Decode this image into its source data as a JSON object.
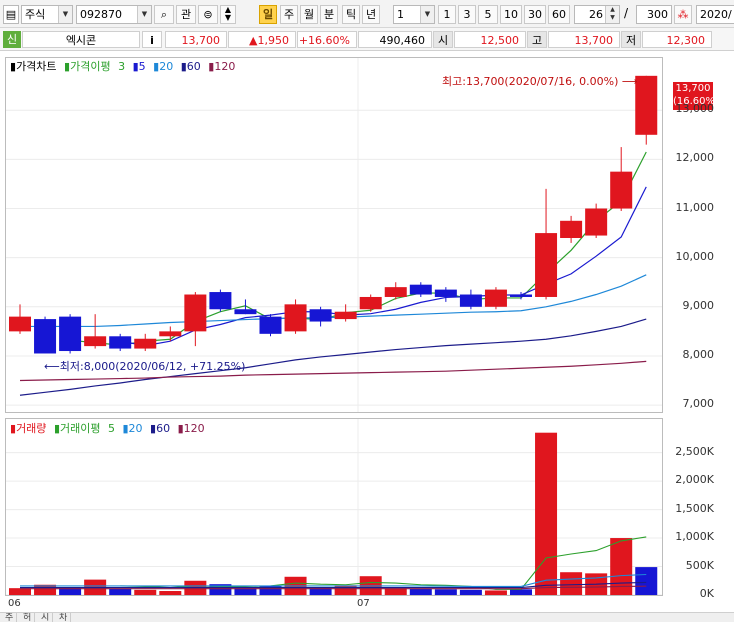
{
  "toolbar": {
    "market": "주식",
    "code": "092870",
    "gwan": "관",
    "periods": [
      "일",
      "주",
      "월",
      "분",
      "틱",
      "년"
    ],
    "active_period": "일",
    "interval": "1",
    "quick": [
      "1",
      "3",
      "5",
      "10",
      "30",
      "60"
    ],
    "count": "26",
    "slash": "/",
    "total": "300",
    "date": "2020/"
  },
  "info": {
    "flag": "신",
    "name": "엑시콘",
    "i": "i",
    "price": "13,700",
    "change": "▲1,950",
    "rate": "+16.60%",
    "volume": "490,460",
    "open_label": "시",
    "open": "12,500",
    "high_label": "고",
    "high": "13,700",
    "low_label": "저",
    "low": "12,300"
  },
  "legend1": {
    "name": "가격차트",
    "ma_label": "가격이평",
    "ma": [
      "3",
      "5",
      "20",
      "60",
      "120"
    ]
  },
  "legend2": {
    "name": "거래량",
    "ma_label": "거래이평",
    "ma": [
      "5",
      "20",
      "60",
      "120"
    ]
  },
  "annotations": {
    "high": "최고:13,700(2020/07/16, 0.00%)",
    "low": "최저:8,000(2020/06/12, +71.25%)",
    "current_price": "13,700",
    "current_rate": "(16.60%)"
  },
  "colors": {
    "up": "#e0161e",
    "down": "#1616d4",
    "ma3": "#2ca02c",
    "ma5": "#1a1ad0",
    "ma20": "#1e88d8",
    "ma60": "#1c1c8a",
    "ma120": "#8a1c4a"
  },
  "bottom_tabs": [
    "주",
    "허",
    "시",
    "차"
  ],
  "chart_data": [
    {
      "type": "candlestick",
      "title": "가격차트",
      "x_ticks": [
        "06",
        "07"
      ],
      "y_ticks": [
        7000,
        8000,
        9000,
        10000,
        11000,
        12000,
        13000
      ],
      "ylim": [
        6900,
        13900
      ],
      "candles": [
        {
          "o": 8500,
          "h": 9050,
          "l": 8450,
          "c": 8800
        },
        {
          "o": 8750,
          "h": 8800,
          "l": 8050,
          "c": 8050
        },
        {
          "o": 8800,
          "h": 8850,
          "l": 8050,
          "c": 8100
        },
        {
          "o": 8200,
          "h": 8850,
          "l": 8150,
          "c": 8400
        },
        {
          "o": 8400,
          "h": 8450,
          "l": 8100,
          "c": 8150
        },
        {
          "o": 8150,
          "h": 8450,
          "l": 8100,
          "c": 8350
        },
        {
          "o": 8400,
          "h": 8600,
          "l": 8300,
          "c": 8500
        },
        {
          "o": 8500,
          "h": 9300,
          "l": 8200,
          "c": 9250
        },
        {
          "o": 9300,
          "h": 9350,
          "l": 8900,
          "c": 8950
        },
        {
          "o": 8950,
          "h": 9150,
          "l": 8850,
          "c": 8850
        },
        {
          "o": 8800,
          "h": 8850,
          "l": 8400,
          "c": 8450
        },
        {
          "o": 8500,
          "h": 9150,
          "l": 8450,
          "c": 9050
        },
        {
          "o": 8950,
          "h": 9000,
          "l": 8600,
          "c": 8700
        },
        {
          "o": 8750,
          "h": 9050,
          "l": 8700,
          "c": 8900
        },
        {
          "o": 8950,
          "h": 9250,
          "l": 8900,
          "c": 9200
        },
        {
          "o": 9200,
          "h": 9500,
          "l": 9150,
          "c": 9400
        },
        {
          "o": 9450,
          "h": 9500,
          "l": 9200,
          "c": 9250
        },
        {
          "o": 9350,
          "h": 9400,
          "l": 9100,
          "c": 9200
        },
        {
          "o": 9250,
          "h": 9350,
          "l": 8950,
          "c": 9000
        },
        {
          "o": 9000,
          "h": 9400,
          "l": 8950,
          "c": 9350
        },
        {
          "o": 9250,
          "h": 9300,
          "l": 9150,
          "c": 9200
        },
        {
          "o": 9200,
          "h": 11400,
          "l": 9150,
          "c": 10500
        },
        {
          "o": 10400,
          "h": 10850,
          "l": 10300,
          "c": 10750
        },
        {
          "o": 10450,
          "h": 11100,
          "l": 10400,
          "c": 11000
        },
        {
          "o": 11000,
          "h": 12250,
          "l": 10950,
          "c": 11750
        },
        {
          "o": 12500,
          "h": 13700,
          "l": 12300,
          "c": 13700
        }
      ],
      "series": [
        {
          "name": "3",
          "values": [
            null,
            null,
            8320,
            8270,
            8220,
            8300,
            8340,
            8700,
            8900,
            9020,
            8750,
            8780,
            8730,
            8880,
            8930,
            9170,
            9280,
            9280,
            9150,
            9180,
            9180,
            9680,
            10150,
            10750,
            11150,
            12150
          ]
        },
        {
          "name": "5",
          "values": [
            null,
            null,
            null,
            null,
            8300,
            8210,
            8300,
            8530,
            8640,
            8780,
            8830,
            8900,
            8900,
            8830,
            8860,
            8950,
            9090,
            9190,
            9210,
            9240,
            9240,
            9460,
            9670,
            10030,
            10420,
            11440
          ]
        },
        {
          "name": "20",
          "values": [
            8600,
            8600,
            8600,
            8600,
            8620,
            8650,
            8680,
            8700,
            8720,
            8740,
            8760,
            8770,
            8780,
            8790,
            8810,
            8830,
            8850,
            8870,
            8890,
            8900,
            8920,
            9000,
            9110,
            9250,
            9420,
            9650
          ]
        },
        {
          "name": "60",
          "values": [
            7200,
            7260,
            7320,
            7390,
            7450,
            7520,
            7580,
            7640,
            7700,
            7760,
            7840,
            7920,
            7980,
            8030,
            8080,
            8130,
            8170,
            8210,
            8240,
            8270,
            8300,
            8340,
            8410,
            8500,
            8600,
            8750
          ]
        },
        {
          "name": "120",
          "values": [
            7500,
            7510,
            7520,
            7530,
            7540,
            7550,
            7570,
            7580,
            7590,
            7610,
            7620,
            7630,
            7640,
            7650,
            7660,
            7670,
            7680,
            7690,
            7710,
            7730,
            7750,
            7770,
            7790,
            7820,
            7850,
            7890
          ]
        }
      ]
    },
    {
      "type": "bar",
      "title": "거래량",
      "y_ticks": [
        0,
        500,
        1000,
        1500,
        2000,
        2500
      ],
      "y_tick_labels": [
        "0K",
        "500K",
        "1,000K",
        "1,500K",
        "2,000K",
        "2,500K"
      ],
      "ylim": [
        0,
        2950
      ],
      "values": [
        120,
        180,
        130,
        270,
        110,
        90,
        70,
        250,
        190,
        120,
        150,
        320,
        130,
        170,
        330,
        120,
        110,
        100,
        90,
        80,
        100,
        2850,
        400,
        380,
        1000,
        490
      ],
      "up": [
        true,
        true,
        false,
        true,
        false,
        true,
        true,
        true,
        false,
        false,
        false,
        true,
        false,
        true,
        true,
        true,
        false,
        false,
        false,
        true,
        false,
        true,
        true,
        true,
        true,
        false
      ],
      "series": [
        {
          "name": "5",
          "values": [
            null,
            null,
            null,
            null,
            160,
            150,
            130,
            160,
            150,
            150,
            160,
            210,
            190,
            180,
            220,
            210,
            180,
            170,
            150,
            100,
            100,
            650,
            720,
            780,
            950,
            1020
          ]
        },
        {
          "name": "20",
          "values": [
            160,
            160,
            160,
            160,
            160,
            160,
            160,
            160,
            160,
            160,
            160,
            160,
            160,
            160,
            160,
            160,
            160,
            155,
            150,
            150,
            150,
            260,
            280,
            300,
            340,
            360
          ]
        },
        {
          "name": "60",
          "values": [
            130,
            130,
            130,
            130,
            130,
            130,
            130,
            130,
            130,
            130,
            130,
            130,
            130,
            130,
            130,
            130,
            130,
            130,
            130,
            130,
            130,
            170,
            180,
            190,
            210,
            220
          ]
        },
        {
          "name": "120",
          "values": [
            110,
            110,
            110,
            110,
            110,
            110,
            110,
            110,
            110,
            110,
            110,
            110,
            110,
            110,
            110,
            110,
            110,
            110,
            110,
            110,
            110,
            130,
            135,
            140,
            150,
            155
          ]
        }
      ]
    }
  ]
}
